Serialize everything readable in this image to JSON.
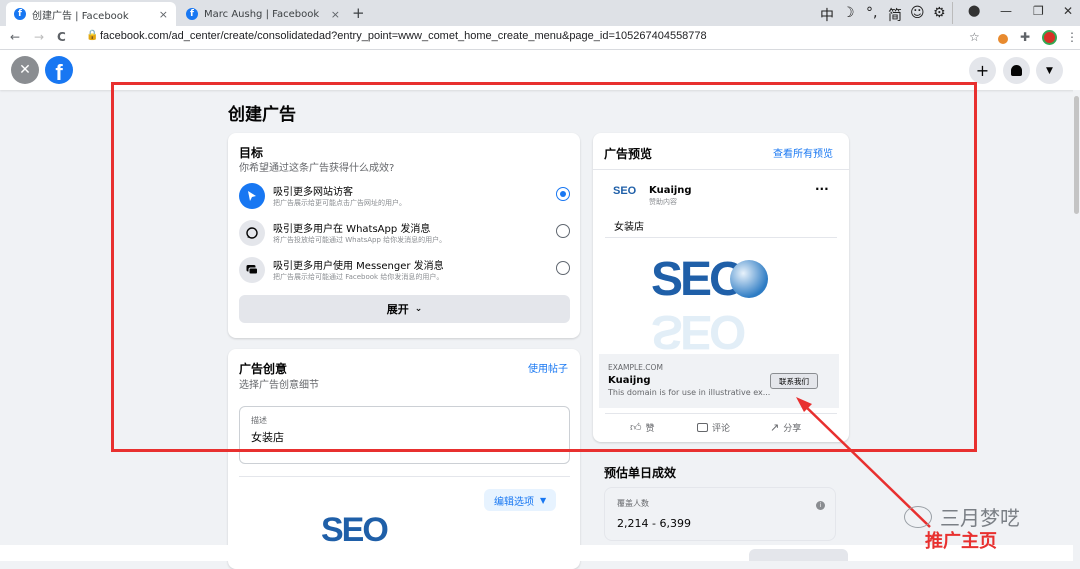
{
  "browser": {
    "tabs": [
      {
        "title": "创建广告 | Facebook",
        "close": "×"
      },
      {
        "title": "Marc Aushg | Facebook",
        "close": "×"
      }
    ],
    "new_tab": "+",
    "ime": [
      "中",
      "☽",
      "°,",
      "简",
      "☺",
      "⚙"
    ],
    "window_controls": [
      "—",
      "❐",
      "✕"
    ],
    "url": "facebook.com/ad_center/create/consolidatedad?entry_point=www_comet_home_create_menu&page_id=105267404558778",
    "nav": [
      "←",
      "→",
      "C"
    ]
  },
  "fb_header": {
    "logo": "f",
    "close": "✕",
    "right_buttons": [
      "+",
      "🔔",
      "▼"
    ]
  },
  "page": {
    "title": "创建广告",
    "objective": {
      "title": "目标",
      "subtitle": "你希望通过这条广告获得什么成效?",
      "options": [
        {
          "title": "吸引更多网站访客",
          "desc": "把广告展示给更可能点击广告网址的用户。",
          "selected": true,
          "icon": "cursor-icon"
        },
        {
          "title": "吸引更多用户在 WhatsApp 发消息",
          "desc": "将广告投放给可能通过 WhatsApp 给你发消息的用户。",
          "selected": false,
          "icon": "whatsapp-icon"
        },
        {
          "title": "吸引更多用户使用 Messenger 发消息",
          "desc": "把广告展示给可能通过 Facebook 给你发消息的用户。",
          "selected": false,
          "icon": "messenger-icon"
        }
      ],
      "expand": "展开"
    },
    "creative": {
      "title": "广告创意",
      "subtitle": "选择广告创意细节",
      "use_post": "使用帖子",
      "desc_label": "描述",
      "desc_value": "女装店",
      "edit_options": "编辑选项"
    },
    "preview": {
      "title": "广告预览",
      "see_all": "查看所有预览",
      "page_name": "Kuaijng",
      "sponsored": "赞助内容",
      "post_text": "女装店",
      "image_text": "SEO",
      "domain": "EXAMPLE.COM",
      "headline": "Kuaijng",
      "link_desc": "This domain is for use in illustrative ex...",
      "cta": "联系我们",
      "actions": [
        "赞",
        "评论",
        "分享"
      ]
    },
    "estimate": {
      "title": "预估单日成效",
      "reach_label": "覆盖人数",
      "reach_value": "2,214 - 6,399"
    }
  },
  "annotation": {
    "label": "推广主页",
    "watermark": "三月梦呓"
  },
  "colors": {
    "fb_blue": "#1877f2",
    "annotation_red": "#e8302f"
  }
}
